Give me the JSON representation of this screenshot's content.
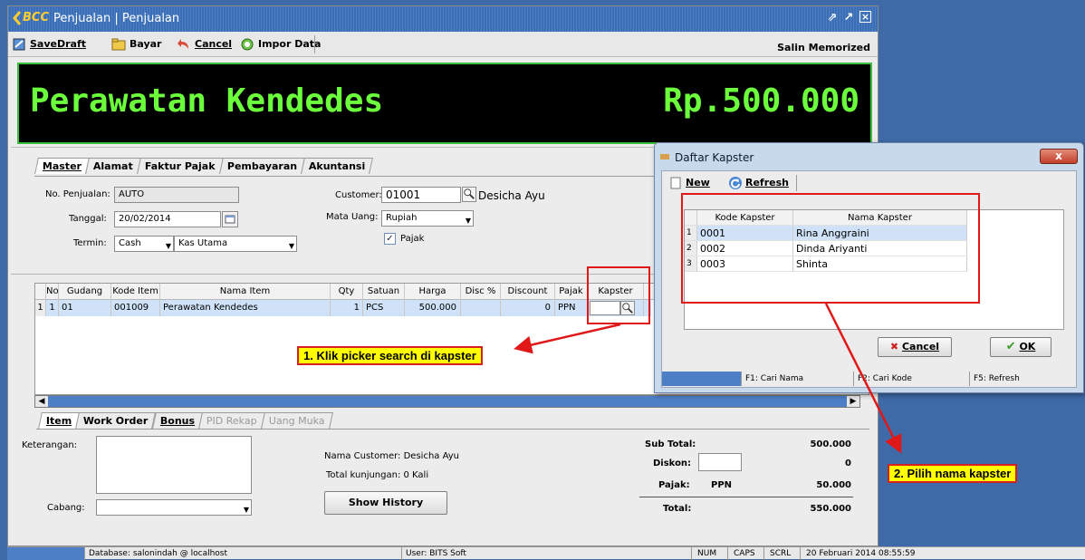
{
  "window": {
    "title": "Penjualan | Penjualan",
    "logo_text": "BCC"
  },
  "toolbar": {
    "savedraft": "SaveDraft",
    "bayar": "Bayar",
    "cancel": "Cancel",
    "impor": "Impor Data",
    "salin": "Salin Memorized"
  },
  "banner": {
    "item": "Perawatan Kendedes",
    "amount": "Rp.500.000"
  },
  "tabs_top": [
    "Master",
    "Alamat",
    "Faktur Pajak",
    "Pembayaran",
    "Akuntansi"
  ],
  "form": {
    "no_penjualan_label": "No. Penjualan:",
    "no_penjualan": "AUTO",
    "tanggal_label": "Tanggal:",
    "tanggal": "20/02/2014",
    "termin_label": "Termin:",
    "termin": "Cash",
    "kas": "Kas Utama",
    "customer_label": "Customer:",
    "customer_code": "01001",
    "customer_name": "Desicha Ayu",
    "mata_uang_label": "Mata Uang:",
    "mata_uang": "Rupiah",
    "pajak_label": "Pajak",
    "pajak_checked": true
  },
  "grid": {
    "columns": [
      "No",
      "Gudang",
      "Kode Item",
      "Nama Item",
      "Qty",
      "Satuan",
      "Harga",
      "Disc %",
      "Discount",
      "Pajak",
      "Kapster"
    ],
    "rows": [
      {
        "rownum": "1",
        "no": "1",
        "gudang": "01",
        "kode": "001009",
        "nama": "Perawatan Kendedes",
        "qty": "1",
        "satuan": "PCS",
        "harga": "500.000",
        "disc": "",
        "discount": "0",
        "pajak": "PPN",
        "kapster": ""
      }
    ]
  },
  "tabs_bottom": [
    "Item",
    "Work Order",
    "Bonus",
    "PID Rekap",
    "Uang Muka"
  ],
  "bottom": {
    "keterangan_label": "Keterangan:",
    "cabang_label": "Cabang:",
    "nama_customer": "Nama Customer:  Desicha Ayu",
    "total_kunjungan": "Total kunjungan:  0 Kali",
    "show_history": "Show History",
    "subtotal_label": "Sub Total:",
    "subtotal": "500.000",
    "diskon_label": "Diskon:",
    "diskon": "0",
    "pajak_label": "Pajak:",
    "pajak_type": "PPN",
    "pajak": "50.000",
    "total_label": "Total:",
    "total": "550.000"
  },
  "statusbar": {
    "database": "Database: salonindah @ localhost",
    "user": "User: BITS Soft",
    "num": "NUM",
    "caps": "CAPS",
    "scrl": "SCRL",
    "datetime": "20 Februari 2014  08:55:59"
  },
  "dialog": {
    "title": "Daftar Kapster",
    "close": "x",
    "new": "New",
    "refresh": "Refresh",
    "col_kode": "Kode Kapster",
    "col_nama": "Nama Kapster",
    "rows": [
      {
        "n": "1",
        "kode": "0001",
        "nama": "Rina Anggraini"
      },
      {
        "n": "2",
        "kode": "0002",
        "nama": "Dinda Ariyanti"
      },
      {
        "n": "3",
        "kode": "0003",
        "nama": "Shinta"
      }
    ],
    "cancel": "Cancel",
    "ok": "OK",
    "status": [
      "F1: Cari Nama",
      "F2: Cari Kode",
      "F5: Refresh"
    ]
  },
  "annotations": {
    "step1": "1. Klik picker search di kapster",
    "step2": "2. Pilih nama kapster"
  },
  "colors": {
    "banner_text": "#6cff3c",
    "titlebar": "#3a6fb8",
    "desktop": "#3f6aa8",
    "annotation_red": "#e01818",
    "annotation_yellow": "#ffff00"
  }
}
